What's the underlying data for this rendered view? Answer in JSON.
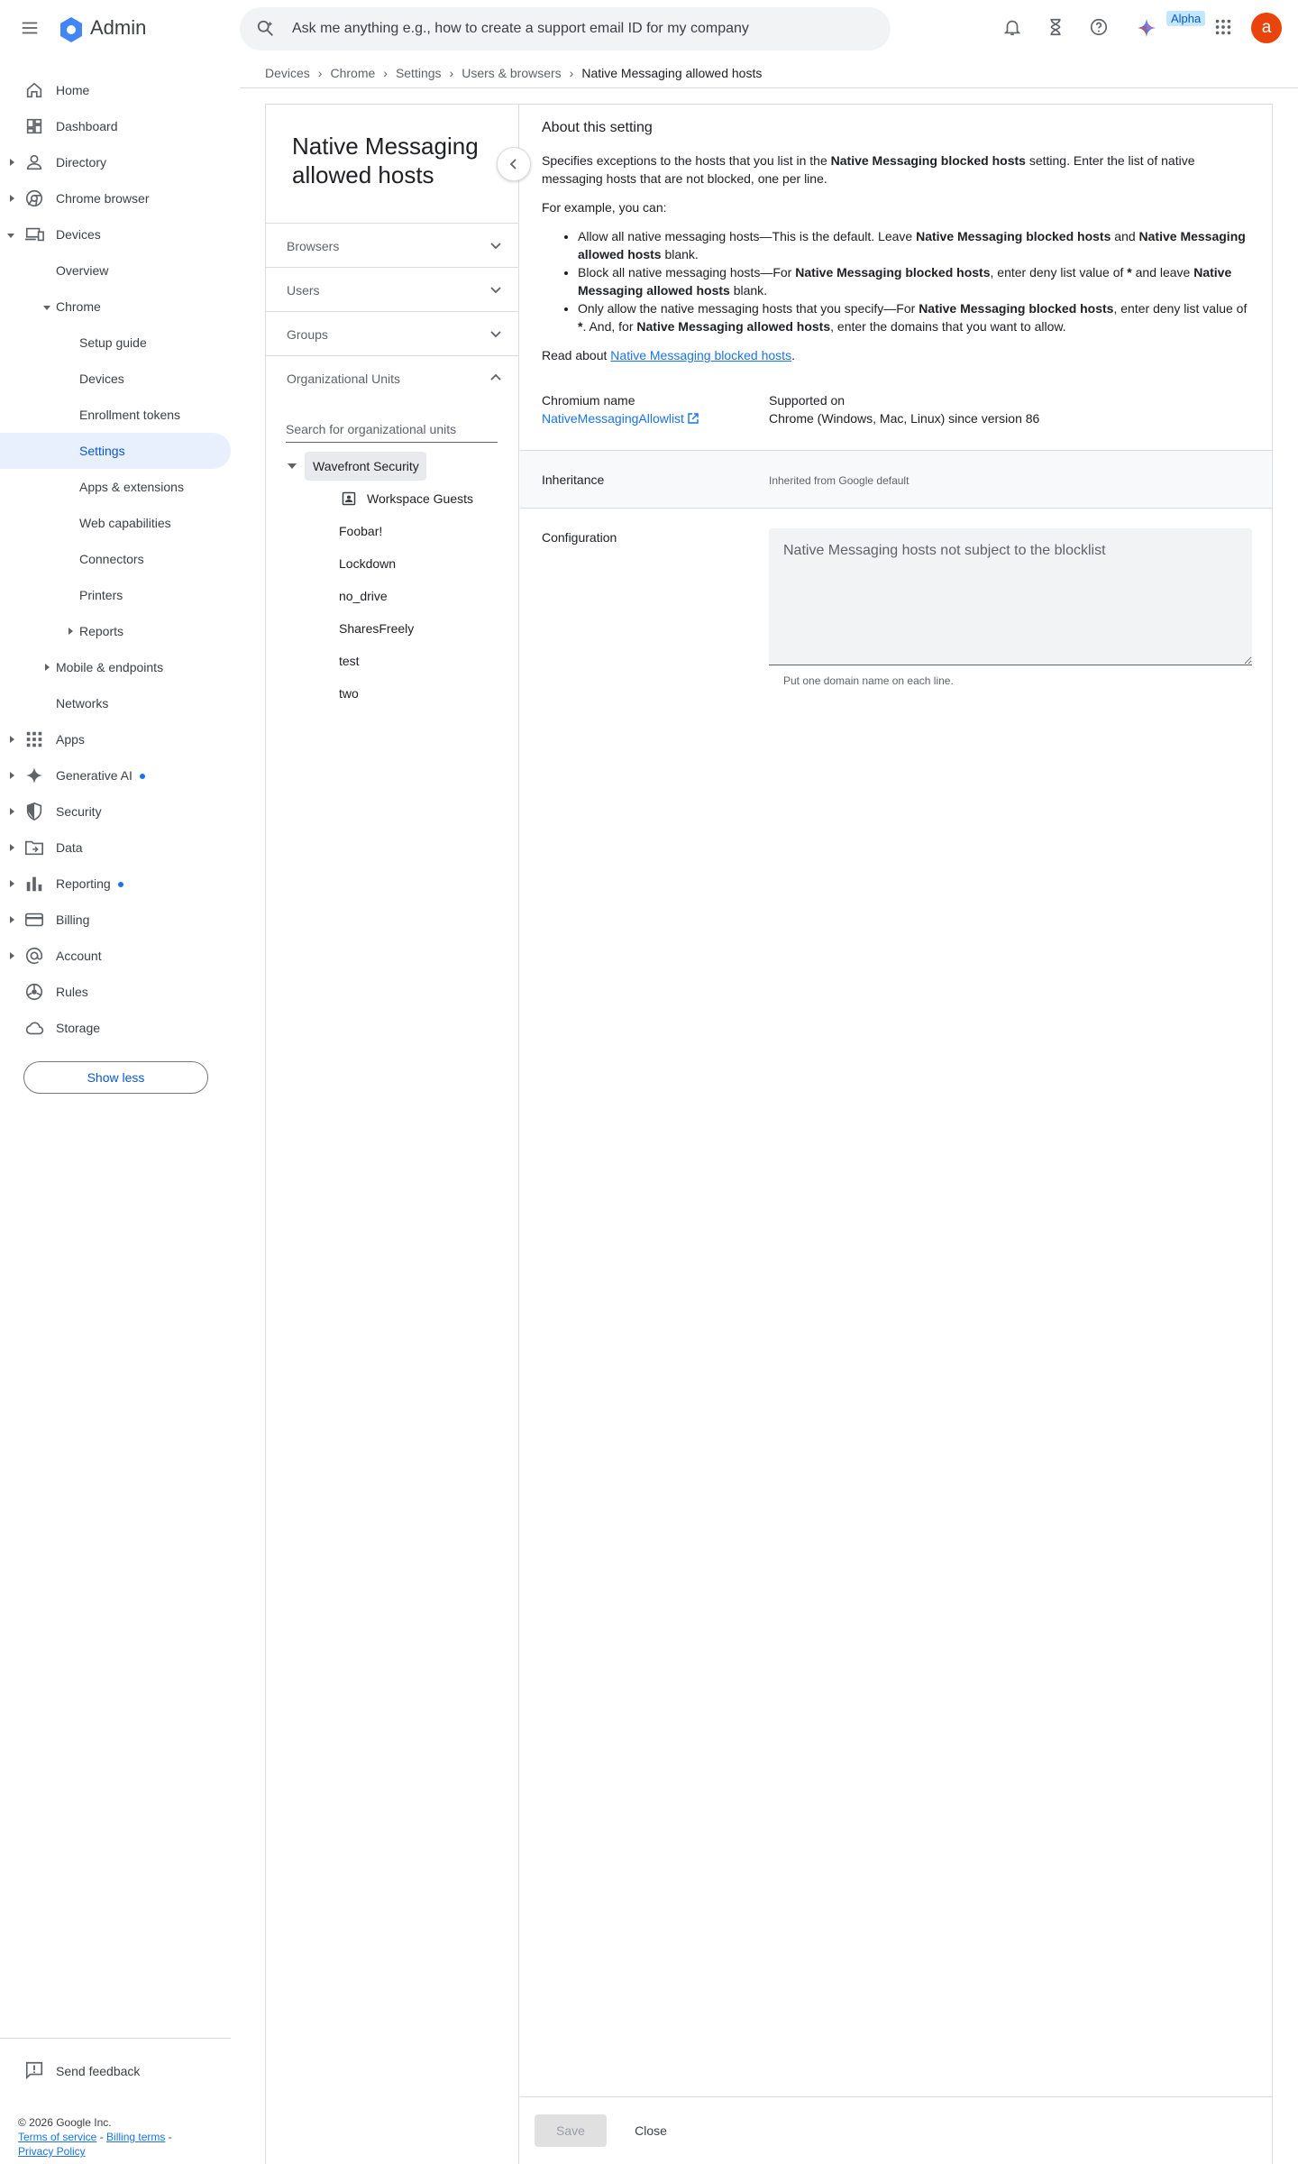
{
  "app": {
    "name": "Admin",
    "search_placeholder": "Ask me anything e.g., how to create a support email ID for my company",
    "alpha_badge": "Alpha",
    "avatar_letter": "a",
    "avatar_color": "#e8440b",
    "accent_color": "#1a73e8"
  },
  "breadcrumb": [
    "Devices",
    "Chrome",
    "Settings",
    "Users & browsers",
    "Native Messaging allowed hosts"
  ],
  "sidebar": {
    "items": [
      {
        "label": "Home",
        "icon": "home-icon"
      },
      {
        "label": "Dashboard",
        "icon": "dashboard-icon"
      },
      {
        "label": "Directory",
        "icon": "person-icon"
      },
      {
        "label": "Chrome browser",
        "icon": "chrome-icon"
      },
      {
        "label": "Devices",
        "icon": "devices-icon"
      },
      {
        "label": "Overview"
      },
      {
        "label": "Chrome"
      },
      {
        "label": "Setup guide"
      },
      {
        "label": "Devices"
      },
      {
        "label": "Enrollment tokens"
      },
      {
        "label": "Settings"
      },
      {
        "label": "Apps & extensions"
      },
      {
        "label": "Web capabilities"
      },
      {
        "label": "Connectors"
      },
      {
        "label": "Printers"
      },
      {
        "label": "Reports"
      },
      {
        "label": "Mobile & endpoints"
      },
      {
        "label": "Networks"
      },
      {
        "label": "Apps",
        "icon": "apps-grid-icon"
      },
      {
        "label": "Generative AI",
        "icon": "sparkle-icon"
      },
      {
        "label": "Security",
        "icon": "shield-icon"
      },
      {
        "label": "Data",
        "icon": "folder-icon"
      },
      {
        "label": "Reporting",
        "icon": "bar-chart-icon"
      },
      {
        "label": "Billing",
        "icon": "credit-card-icon"
      },
      {
        "label": "Account",
        "icon": "at-sign-icon"
      },
      {
        "label": "Rules",
        "icon": "rules-icon"
      },
      {
        "label": "Storage",
        "icon": "cloud-icon"
      }
    ],
    "show_less": "Show less",
    "send_feedback": "Send feedback",
    "footer": {
      "copyright": "© 2026 Google Inc.",
      "terms": "Terms of service",
      "billing_terms": "Billing terms",
      "privacy": "Privacy Policy",
      "sep1": " - ",
      "sep2": " -"
    }
  },
  "setting": {
    "title": "Native Messaging allowed hosts",
    "accordion": {
      "browsers": "Browsers",
      "users": "Users",
      "groups": "Groups",
      "org_units": "Organizational Units"
    },
    "ou_search_placeholder": "Search for organizational units",
    "ou_tree": {
      "root": "Wavefront Security",
      "children": [
        "Workspace Guests",
        "Foobar!",
        "Lockdown",
        "no_drive",
        "SharesFreely",
        "test",
        "two"
      ]
    },
    "about": {
      "heading": "About this setting",
      "p1": {
        "a": "Specifies exceptions to the hosts that you list in the ",
        "b": "Native Messaging blocked hosts",
        "c": " setting. Enter the list of native messaging hosts that are not blocked, one per line."
      },
      "example_intro": "For example, you can:",
      "bullets": [
        {
          "a": "Allow all native messaging hosts—This is the default. Leave ",
          "b": "Native Messaging blocked hosts",
          "c": " and ",
          "d": "Native Messaging allowed hosts",
          "e": " blank."
        },
        {
          "a": "Block all native messaging hosts—For ",
          "b": "Native Messaging blocked hosts",
          "c": ", enter deny list value of ",
          "d": "*",
          "e": " and leave ",
          "f": "Native Messaging allowed hosts",
          "g": " blank."
        },
        {
          "a": "Only allow the native messaging hosts that you specify—For ",
          "b": "Native Messaging blocked hosts",
          "c": ", enter deny list value of ",
          "d": "*",
          "e": ". And, for ",
          "f": "Native Messaging allowed hosts",
          "g": ", enter the domains that you want to allow."
        }
      ],
      "read_about": {
        "a": "Read about ",
        "link": "Native Messaging blocked hosts",
        "c": "."
      }
    },
    "chromium_name_label": "Chromium name",
    "chromium_name_value": "NativeMessagingAllowlist",
    "supported_on_label": "Supported on",
    "supported_on_value": "Chrome (Windows, Mac, Linux) since version 86",
    "inheritance_label": "Inheritance",
    "inheritance_value": "Inherited from Google default",
    "configuration_label": "Configuration",
    "configuration_placeholder": "Native Messaging hosts not subject to the blocklist",
    "configuration_value": "",
    "configuration_hint": "Put one domain name on each line.",
    "save_label": "Save",
    "close_label": "Close"
  }
}
